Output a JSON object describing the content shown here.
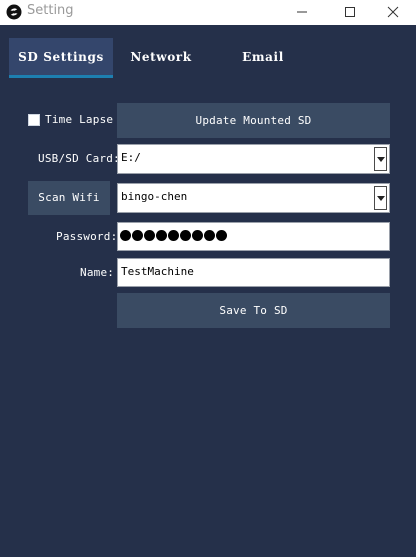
{
  "window": {
    "title": "Setting"
  },
  "tabs": [
    {
      "label": "SD Settings",
      "active": true
    },
    {
      "label": "Network",
      "active": false
    },
    {
      "label": "Email",
      "active": false
    }
  ],
  "form": {
    "time_lapse": {
      "label": "Time Lapse",
      "checked": false
    },
    "update_button": "Update Mounted SD",
    "usb_card": {
      "label": "USB/SD Card:",
      "value": "E:/"
    },
    "scan_wifi_button": "Scan Wifi",
    "wifi": {
      "value": "bingo-chen"
    },
    "password": {
      "label": "Password:",
      "masked_count": 9
    },
    "name": {
      "label": "Name:",
      "value": "TestMachine"
    },
    "save_button": "Save To SD"
  },
  "colors": {
    "background": "#25304a",
    "active_tab": "#34466c",
    "tab_underline": "#1d7fb0",
    "button": "#3a4b63"
  }
}
